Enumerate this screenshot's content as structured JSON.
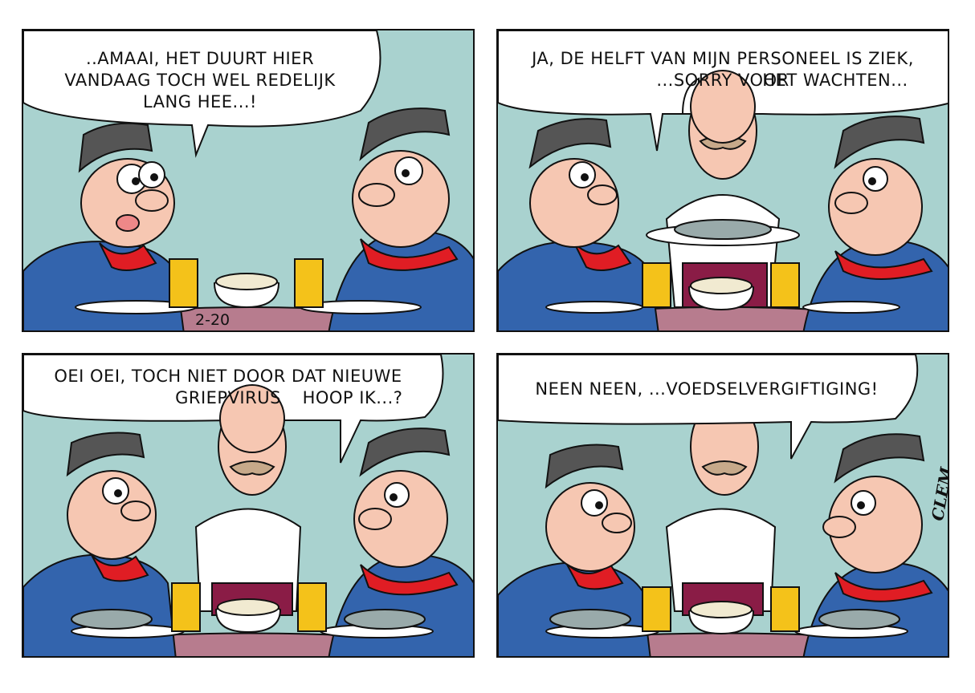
{
  "colors": {
    "wall": "#a9d2cf",
    "uniform_blue": "#3364ad",
    "scarf_red": "#e01d24",
    "cap": "#555555",
    "skin": "#f6c7b2",
    "table": "#b77c8e",
    "beer": "#f4c21a",
    "apron": "#8a1c46"
  },
  "panels": [
    {
      "speech": "..AMAAI, HET DUURT HIER\nVANDAAG TOCH WEL REDELIJK\nLANG HEE...!",
      "stamp": "2-20"
    },
    {
      "speech_left": "JA, DE HELFT VAN MIJN PERSONEEL IS ZIEK,\n...SORRY  VOOR",
      "speech_right": "HET WACHTEN..."
    },
    {
      "speech_left": "OEI OEI,  TOCH NIET DOOR DAT NIEUWE\nGRIEPVIRUS",
      "speech_right": "HOOP IK...?"
    },
    {
      "speech": "NEEN NEEN, ...VOEDSELVERGIFTIGING!",
      "signature": "CLEM"
    }
  ]
}
